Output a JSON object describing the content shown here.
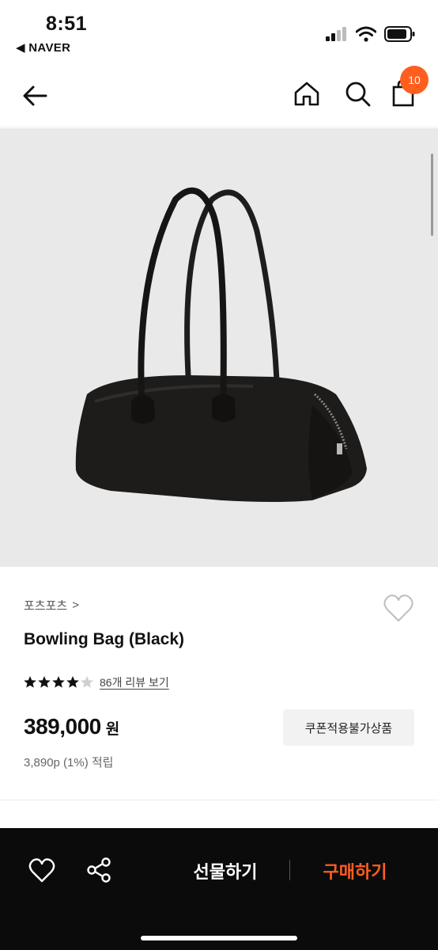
{
  "status_bar": {
    "time": "8:51",
    "back_app": "◀ NAVER",
    "icons": [
      "signal-icon",
      "wifi-icon",
      "battery-icon"
    ]
  },
  "nav": {
    "icons": [
      "back-arrow-icon",
      "home-icon",
      "search-icon",
      "cart-icon"
    ],
    "cart_count": "10",
    "accent_color": "#ff5e1f"
  },
  "product": {
    "brand": "포츠포츠",
    "brand_chevron": ">",
    "title": "Bowling Bag (Black)",
    "rating": 4.5,
    "review_link": "86개 리뷰 보기",
    "price": "389,000",
    "price_unit": "원",
    "coupon_label": "쿠폰적용불가상품",
    "points": "3,890p (1%) 적립"
  },
  "bottom_bar": {
    "gift_label": "선물하기",
    "buy_label": "구매하기",
    "icons": [
      "heart-icon",
      "share-icon"
    ]
  }
}
